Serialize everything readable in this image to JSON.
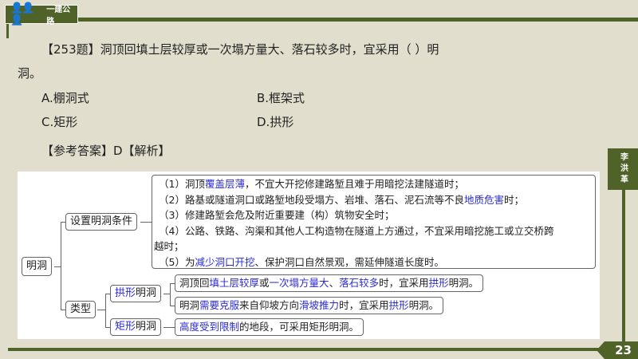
{
  "header": {
    "brand": "一建公路",
    "people_icon": "people-icon"
  },
  "side_tab": "李洪革",
  "page_number": "23",
  "question": {
    "text": "【253题】洞顶回填土层较厚或一次塌方量大、落石较多时，宜采用（     ）明",
    "text_cont": "洞。",
    "options": [
      "A.棚洞式",
      "B.框架式",
      "C.矩形",
      "D.拱形"
    ],
    "answer": "【参考答案】D【解析】"
  },
  "mindmap": {
    "root": "明洞",
    "conditions_label": "设置明洞条件",
    "conditions": [
      [
        "（1）洞顶",
        "覆盖层薄",
        "，不宜大开挖修建路堑且难于用暗挖法建隧道时；"
      ],
      [
        "（2）路基或隧道洞口或路堑地段受塌方、岩堆、落石、泥石流等不良",
        "地质危害",
        "时；"
      ],
      [
        "（3）修建路堑会危及附近重要建（构）筑物安全时；",
        "",
        ""
      ],
      [
        "（4）公路、铁路、沟渠和其他人工构造物在隧道上方通过，不宜采用暗挖施工或立交桥跨",
        "",
        ""
      ],
      [
        "越时；",
        "",
        ""
      ],
      [
        "（5）为",
        "减少洞口开挖",
        "、保护洞口自然景观，需延伸隧道长度时。"
      ]
    ],
    "types_label": "类型",
    "arch": {
      "label_b": "拱形",
      "label": "明洞",
      "items": [
        [
          "洞顶回",
          "填土层较厚",
          "或",
          "一次塌方量大",
          "、",
          "落石较多",
          "时，宜采用",
          "拱形",
          "明洞。"
        ],
        [
          "明洞",
          "需要克服",
          "来自仰坡方向",
          "滑坡推力",
          "时，宜采用",
          "拱形",
          "明洞。"
        ]
      ]
    },
    "rect": {
      "label_b": "矩形",
      "label": "明洞",
      "item": [
        "高度受到限制",
        "的地段，可采用矩形明洞。"
      ]
    }
  }
}
